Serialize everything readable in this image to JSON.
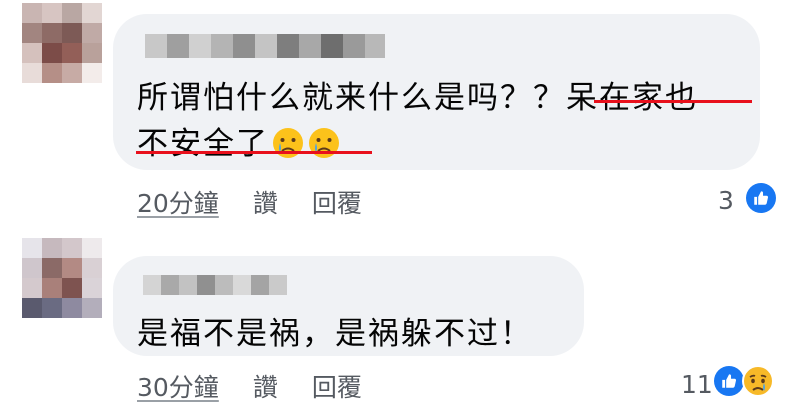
{
  "comments": [
    {
      "text_line1": "所谓怕什么就来什么是吗？？呆在家也",
      "text_line2": "不安全了",
      "emojis": [
        "crying-face-icon",
        "crying-face-icon"
      ],
      "time": "20分鐘",
      "like_label": "讚",
      "reply_label": "回覆",
      "reaction_count": "3",
      "reactions": [
        "like-icon"
      ],
      "highlight_color": "#e8101c"
    },
    {
      "text_line1": "是福不是祸，是祸躲不过！",
      "time": "30分鐘",
      "like_label": "讚",
      "reply_label": "回覆",
      "reaction_count": "11",
      "reactions": [
        "like-icon",
        "sad-face-icon"
      ]
    }
  ],
  "colors": {
    "bubble": "#f0f2f5",
    "like_blue": "#1877f2",
    "meta_text": "#555a61"
  }
}
